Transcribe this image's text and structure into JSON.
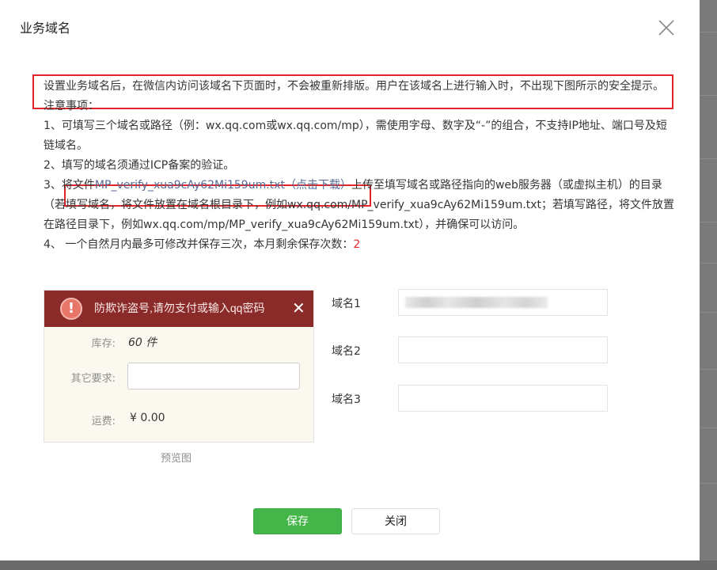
{
  "dialog": {
    "title": "业务域名"
  },
  "notice": {
    "intro": "设置业务域名后，在微信内访问该域名下页面时，不会被重新排版。用户在该域名上进行输入时，不出现下图所示的安全提示。",
    "heading": "注意事项：",
    "item1": "1、可填写三个域名或路径（例：wx.qq.com或wx.qq.com/mp），需使用字母、数字及“-”的组合，不支持IP地址、端口号及短链域名。",
    "item2": "2、填写的域名须通过ICP备案的验证。",
    "item3_prefix": "3、",
    "item3_file_prefix": "将文件",
    "item3_link": "MP_verify_xua9cAy62Mi159um.txt（点击下载）",
    "item3_rest": "上传至填写域名或路径指向的web服务器（或虚拟主机）的目录（若填写域名，将文件放置在域名根目录下，例如wx.qq.com/MP_verify_xua9cAy62Mi159um.txt；若填写路径，将文件放置在路径目录下，例如wx.qq.com/mp/MP_verify_xua9cAy62Mi159um.txt），并确保可以访问。",
    "item4_text": "4、 一个自然月内最多可修改并保存三次，本月剩余保存次数：",
    "item4_count": "2"
  },
  "preview": {
    "warning_text": "防欺诈盗号,请勿支付或输入qq密码",
    "stock_label": "库存:",
    "stock_value": "60 件",
    "other_label": "其它要求:",
    "shipping_label": "运费:",
    "shipping_value": "¥ 0.00",
    "caption": "预览图"
  },
  "domains": [
    {
      "label": "域名1",
      "value": ""
    },
    {
      "label": "域名2",
      "value": ""
    },
    {
      "label": "域名3",
      "value": ""
    }
  ],
  "buttons": {
    "save": "保存",
    "close": "关闭"
  },
  "colors": {
    "primary": "#44b549",
    "link": "#576b95",
    "highlight": "#e0262a",
    "warning_bar": "#8a2b2a"
  }
}
